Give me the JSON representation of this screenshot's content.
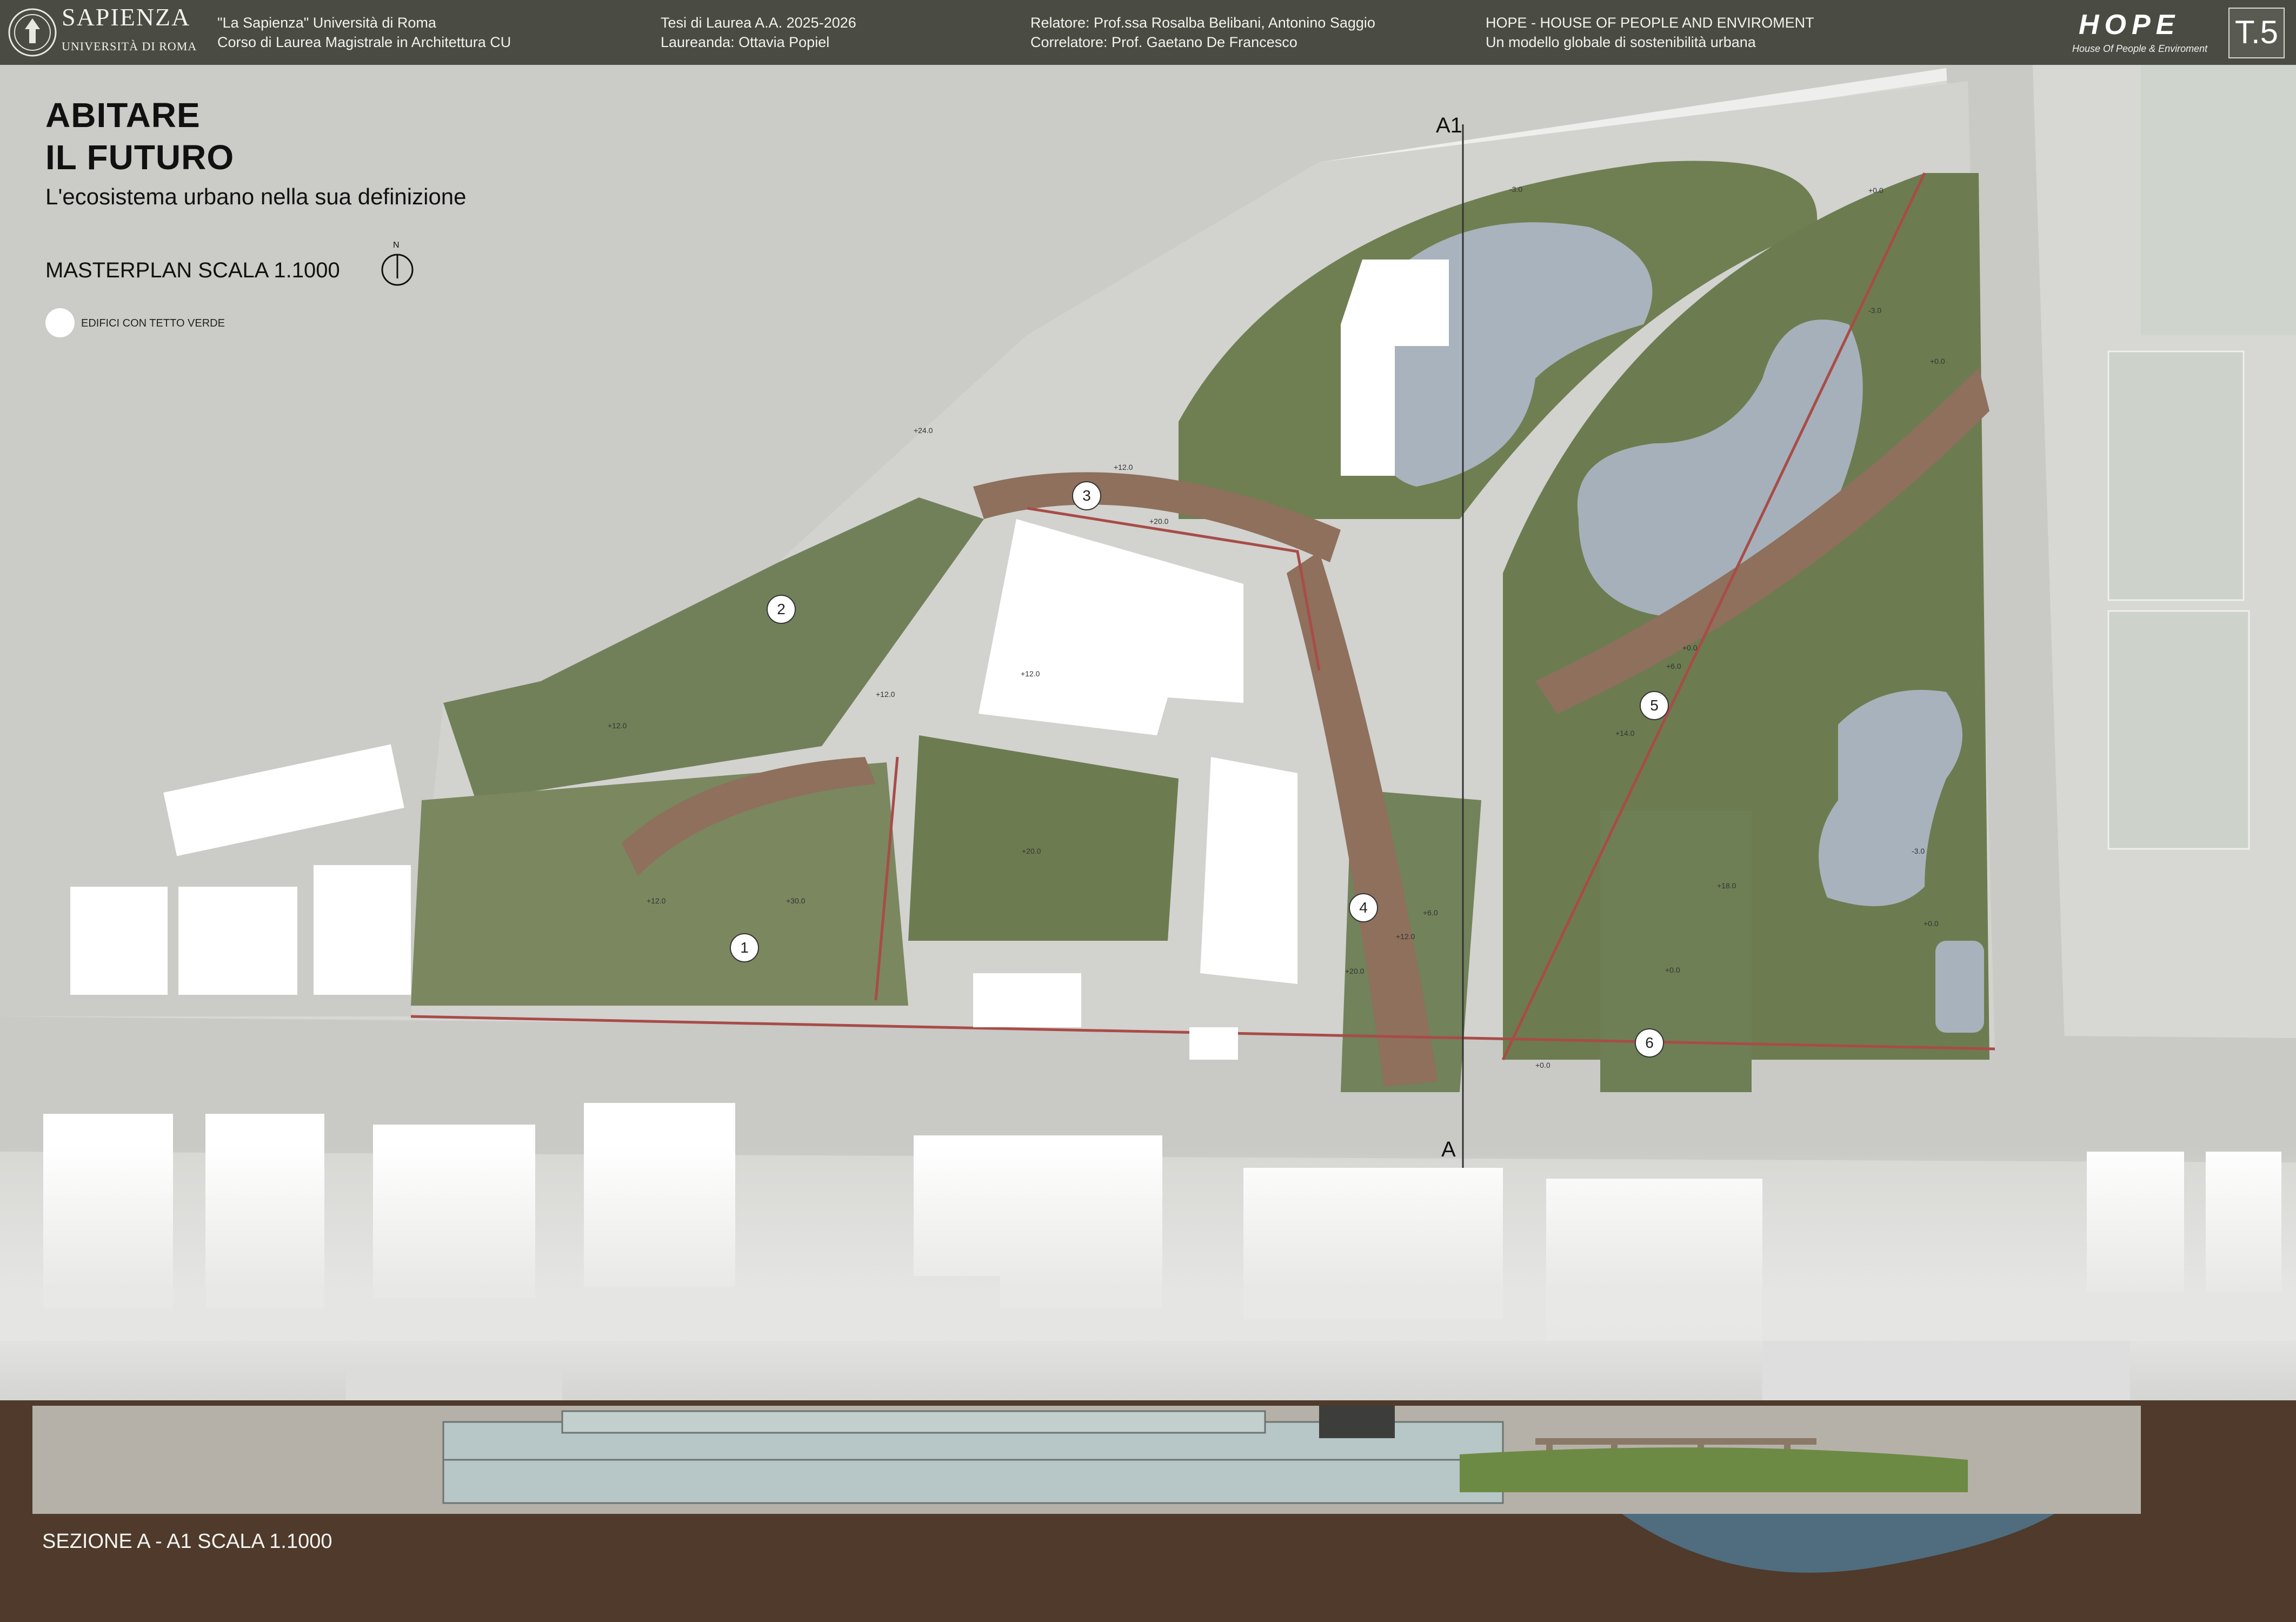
{
  "header": {
    "university_name": "SAPIENZA",
    "university_sub": "UNIVERSITÀ DI ROMA",
    "course_line1": "\"La  Sapienza\"  Università di Roma",
    "course_line2": "Corso di Laurea Magistrale in Architettura CU",
    "thesis_line1": "Tesi di Laurea A.A. 2025-2026",
    "thesis_line2": "Laureanda: Ottavia Popiel",
    "advisor_line1": "Relatore: Prof.ssa Rosalba Belibani, Antonino Saggio",
    "advisor_line2": "Correlatore: Prof. Gaetano De Francesco",
    "project_line1": "HOPE - HOUSE OF PEOPLE AND ENVIROMENT",
    "project_line2": "Un modello globale di sostenibilità urbana",
    "logo_word": "HOPE",
    "logo_tagline": "House Of People & Enviroment",
    "table_code": "T.5"
  },
  "title": {
    "line1": "ABITARE",
    "line2": "IL FUTURO",
    "subtitle": "L'ecosistema urbano nella sua definizione",
    "masterplan_label": "MASTERPLAN SCALA 1.1000",
    "north_label": "N"
  },
  "legend": {
    "green_roof_label": "EDIFICI CON TETTO VERDE"
  },
  "section": {
    "label_a1": "A1",
    "label_a": "A",
    "title": "SEZIONE A - A1 SCALA 1.1000"
  },
  "zones": [
    "1",
    "2",
    "3",
    "4",
    "5",
    "6"
  ],
  "elevations": [
    "+24.0",
    "+12.0",
    "+20.0",
    "+12.0",
    "+12.0",
    "+30.0",
    "+12.0",
    "+20.0",
    "+12.0",
    "+6.0",
    "+20.0",
    "-3.0",
    "+0.0",
    "-3.0",
    "+0.0",
    "+0.0",
    "+6.0",
    "+14.0",
    "+18.0",
    "+0.0",
    "-3.0",
    "+0.0",
    "+0.0",
    "+12.0"
  ],
  "colors": {
    "header_bg": "#4a4c44",
    "road": "#cfcfcc",
    "green": "#6f7f52",
    "water": "#a9b3bd",
    "deck": "#8e705c",
    "red_line": "#a84c48",
    "building": "#ffffff",
    "soil": "#4f3a2c"
  }
}
